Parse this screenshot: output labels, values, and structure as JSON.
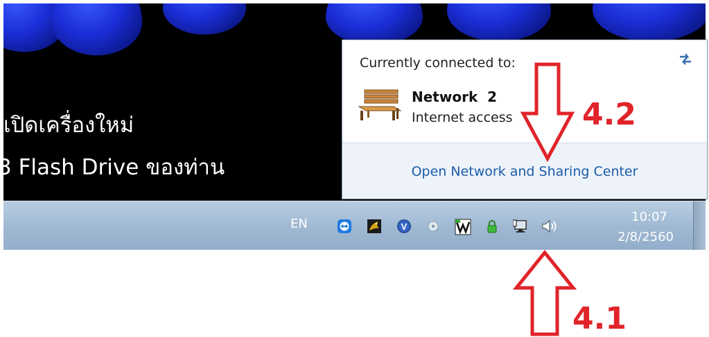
{
  "desktop": {
    "line1": "เปิดเครื่องใหม่",
    "line2": "3 Flash Drive ของท่าน"
  },
  "network_popup": {
    "connected_label": "Currently connected to:",
    "network_name": "Network  2",
    "network_status": "Internet access",
    "open_link": "Open Network and Sharing Center"
  },
  "taskbar": {
    "language": "EN",
    "tray_icons": [
      "teamviewer-icon",
      "dragon-icon",
      "v-shield-icon",
      "disc-icon",
      "vm-icon",
      "lock-icon",
      "network-icon",
      "volume-icon"
    ],
    "clock_time": "10:07",
    "clock_date": "2/8/2560"
  },
  "annotations": {
    "step_a": "4.2",
    "step_b": "4.1",
    "color": "#e0242a"
  }
}
